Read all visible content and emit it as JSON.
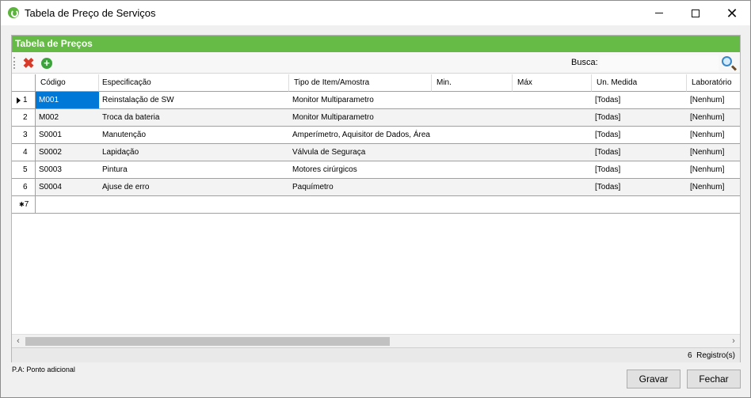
{
  "window": {
    "title": "Tabela de Preço de Serviços",
    "accent": "#65bb45"
  },
  "panel": {
    "header": "Tabela de Preços"
  },
  "toolbar": {
    "delete_icon": "delete-icon",
    "add_icon": "add-icon",
    "search_label": "Busca:",
    "search_value": "",
    "search_icon": "search-icon"
  },
  "grid": {
    "columns": [
      "Código",
      "Especificação",
      "Tipo de Item/Amostra",
      "Min.",
      "Máx",
      "Un. Medida",
      "Laboratório"
    ],
    "rows": [
      {
        "n": "1",
        "codigo": "M001",
        "espec": "Reinstalação de SW",
        "tipo": "Monitor Multiparametro",
        "min": "",
        "max": "",
        "un": "[Todas]",
        "lab": "[Nenhum]"
      },
      {
        "n": "2",
        "codigo": "M002",
        "espec": "Troca da bateria",
        "tipo": "Monitor Multiparametro",
        "min": "",
        "max": "",
        "un": "[Todas]",
        "lab": "[Nenhum]"
      },
      {
        "n": "3",
        "codigo": "S0001",
        "espec": "Manutenção",
        "tipo": "Amperímetro, Aquisitor de Dados, Área ...",
        "min": "",
        "max": "",
        "un": "[Todas]",
        "lab": "[Nenhum]"
      },
      {
        "n": "4",
        "codigo": "S0002",
        "espec": "Lapidação",
        "tipo": "Válvula de Seguraça",
        "min": "",
        "max": "",
        "un": "[Todas]",
        "lab": "[Nenhum]"
      },
      {
        "n": "5",
        "codigo": "S0003",
        "espec": "Pintura",
        "tipo": "Motores cirúrgicos",
        "min": "",
        "max": "",
        "un": "[Todas]",
        "lab": "[Nenhum]"
      },
      {
        "n": "6",
        "codigo": "S0004",
        "espec": "Ajuse de erro",
        "tipo": "Paquímetro",
        "min": "",
        "max": "",
        "un": "[Todas]",
        "lab": "[Nenhum]"
      }
    ],
    "new_row_number": "7",
    "new_row_mark": "✱"
  },
  "status": {
    "count": "6",
    "count_label": "Registro(s)"
  },
  "footer": {
    "note": "P.A: Ponto adicional",
    "save_label": "Gravar",
    "close_label": "Fechar"
  }
}
